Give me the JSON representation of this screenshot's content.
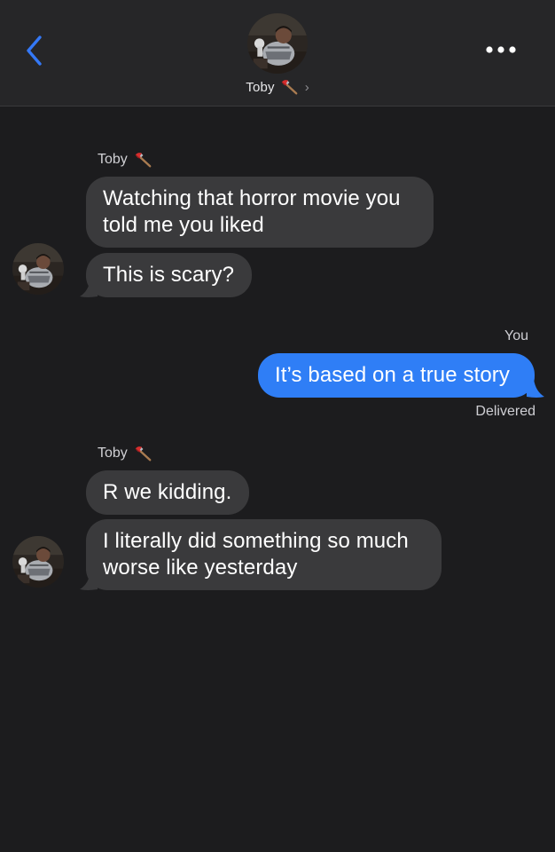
{
  "header": {
    "contact_name": "Toby",
    "contact_emoji": "axe-icon",
    "chevron": "›"
  },
  "conversation": [
    {
      "sender": "Toby",
      "messages": [
        "Watching that horror movie you told me you liked",
        "This is scary?"
      ]
    },
    {
      "sender": "You",
      "messages": [
        "It’s based on a true story"
      ],
      "status": "Delivered"
    },
    {
      "sender": "Toby",
      "messages": [
        "R we kidding.",
        "I literally did something so much worse like yesterday"
      ]
    }
  ],
  "colors": {
    "background": "#1c1c1e",
    "header": "#262628",
    "incoming_bubble": "#3a3a3c",
    "outgoing_bubble": "#2f7ef6",
    "accent": "#3478f6"
  }
}
